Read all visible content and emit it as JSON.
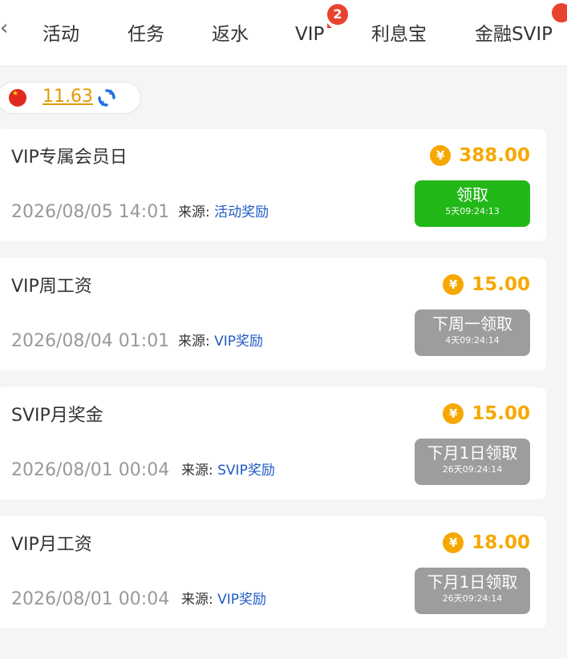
{
  "nav": {
    "back_glyph": "‹",
    "tabs": [
      {
        "label": "活动"
      },
      {
        "label": "任务"
      },
      {
        "label": "返水"
      },
      {
        "label": "VIP",
        "badge": "2"
      },
      {
        "label": "利息宝"
      },
      {
        "label": "金融SVIP"
      }
    ]
  },
  "balance": {
    "amount": "11.63",
    "flag_icon": "china-flag-icon",
    "refresh_icon": "refresh-icon"
  },
  "currency_symbol": "¥",
  "colors": {
    "accent_gold": "#f6a800",
    "claim_active": "#22b818",
    "claim_disabled": "#9d9d9d",
    "badge_red": "#e8432f",
    "source_link": "#1f5bc7"
  },
  "rewards": [
    {
      "title": "VIP专属会员日",
      "amount": "388.00",
      "date": "2026/08/05 14:01",
      "source_label": "来源:",
      "source_value": "活动奖励",
      "button_label": "领取",
      "button_timer": "5天09:24:13",
      "status": "active"
    },
    {
      "title": "VIP周工资",
      "amount": "15.00",
      "date": "2026/08/04 01:01",
      "source_label": "来源:",
      "source_value": "VIP奖励",
      "button_label": "下周一领取",
      "button_timer": "4天09:24:14",
      "status": "disabled"
    },
    {
      "title": "SVIP月奖金",
      "amount": "15.00",
      "date": "2026/08/01 00:04",
      "source_label": "来源:",
      "source_value": "SVIP奖励",
      "button_label": "下月1日领取",
      "button_timer": "26天09:24:14",
      "status": "disabled"
    },
    {
      "title": "VIP月工资",
      "amount": "18.00",
      "date": "2026/08/01 00:04",
      "source_label": "来源:",
      "source_value": "VIP奖励",
      "button_label": "下月1日领取",
      "button_timer": "26天09:24:14",
      "status": "disabled"
    }
  ]
}
